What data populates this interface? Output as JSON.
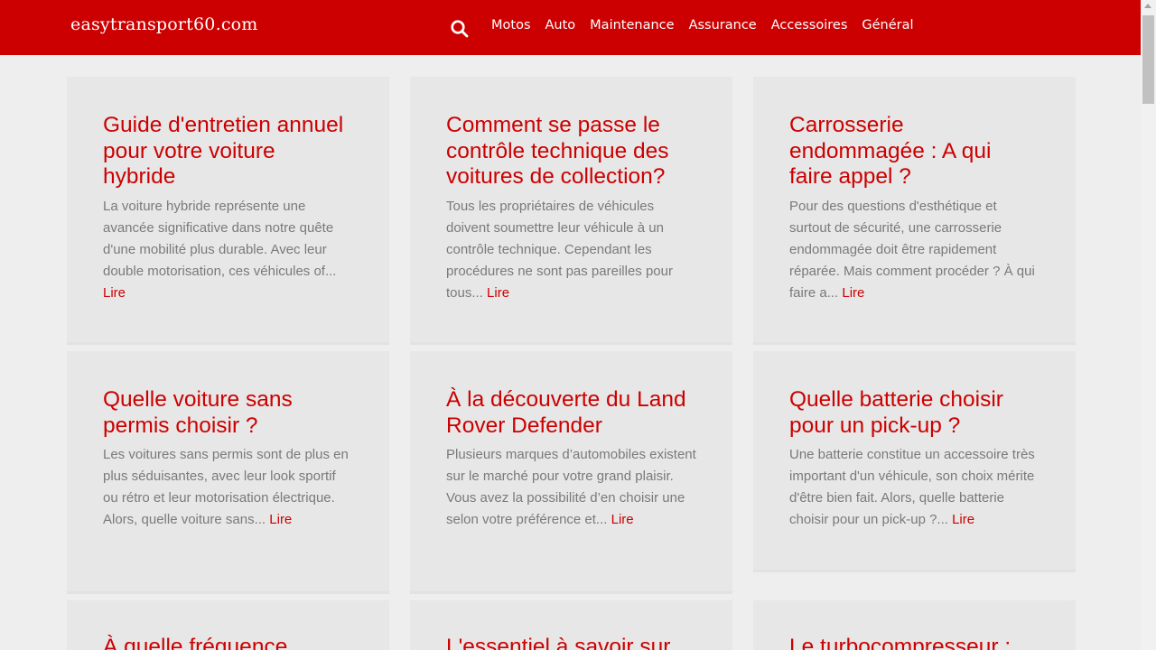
{
  "header": {
    "logo": "easytransport60.com",
    "nav": [
      "Motos",
      "Auto",
      "Maintenance",
      "Assurance",
      "Accessoires",
      "Général"
    ]
  },
  "colors": {
    "accent": "#cc0000",
    "background": "#eeeeee",
    "card": "#e7e7e7"
  },
  "articles": [
    {
      "title": "Guide d'entretien annuel pour votre voiture hybride",
      "excerpt": "La voiture hybride représente une avancée significative dans notre quête d'une mobilité plus durable. Avec leur double motorisation, ces véhicules of...",
      "more": "Lire"
    },
    {
      "title": "Comment se passe le contrôle technique des voitures de collection?",
      "excerpt": "Tous les propriétaires de véhicules doivent soumettre leur véhicule à un contrôle technique. Cependant les procédures ne sont pas pareilles pour tous...",
      "more": "Lire"
    },
    {
      "title": "Carrosserie endommagée : A qui faire appel ?",
      "excerpt": "Pour des questions d'esthétique et surtout de sécurité, une carrosserie endommagée doit être rapidement réparée. Mais comment procéder ? À qui faire a...",
      "more": "Lire"
    },
    {
      "title": "Quelle voiture sans permis choisir ?",
      "excerpt": "Les voitures sans permis sont de plus en plus séduisantes, avec leur look sportif ou rétro et leur motorisation électrique. Alors, quelle voiture sans...",
      "more": "Lire"
    },
    {
      "title": "À la découverte du Land Rover Defender",
      "excerpt": "Plusieurs marques d’automobiles existent sur le marché pour votre grand plaisir.  Vous avez  la possibilité d’en choisir une selon votre préférence et...",
      "more": "Lire"
    },
    {
      "title": "Quelle batterie choisir pour un pick-up ?",
      "excerpt": "Une batterie constitue un accessoire très important d'un véhicule, son choix mérite d'être bien fait. Alors, quelle batterie choisir pour un pick-up ?...",
      "more": "Lire"
    },
    {
      "title": "À quelle fréquence",
      "excerpt": "",
      "more": ""
    },
    {
      "title": "L'essentiel à savoir sur",
      "excerpt": "",
      "more": ""
    },
    {
      "title": "Le turbocompresseur :",
      "excerpt": "",
      "more": ""
    }
  ]
}
